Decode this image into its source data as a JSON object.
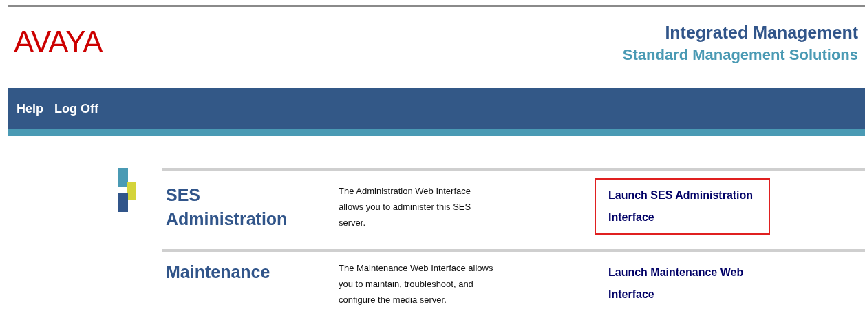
{
  "header": {
    "logo": "AVAYA",
    "title": "Integrated Management",
    "subtitle": "Standard Management Solutions"
  },
  "nav": [
    {
      "label": "Help"
    },
    {
      "label": "Log Off"
    }
  ],
  "rows": [
    {
      "heading": "SES Administration",
      "description": "The Administration Web Interface allows you to administer this SES server.",
      "link": "Launch SES Administration Interface",
      "highlighted": true
    },
    {
      "heading": "Maintenance",
      "description": "The Maintenance Web Interface allows you to maintain, troubleshoot, and configure the media server.",
      "link": "Launch Maintenance Web Interface",
      "highlighted": false
    }
  ]
}
